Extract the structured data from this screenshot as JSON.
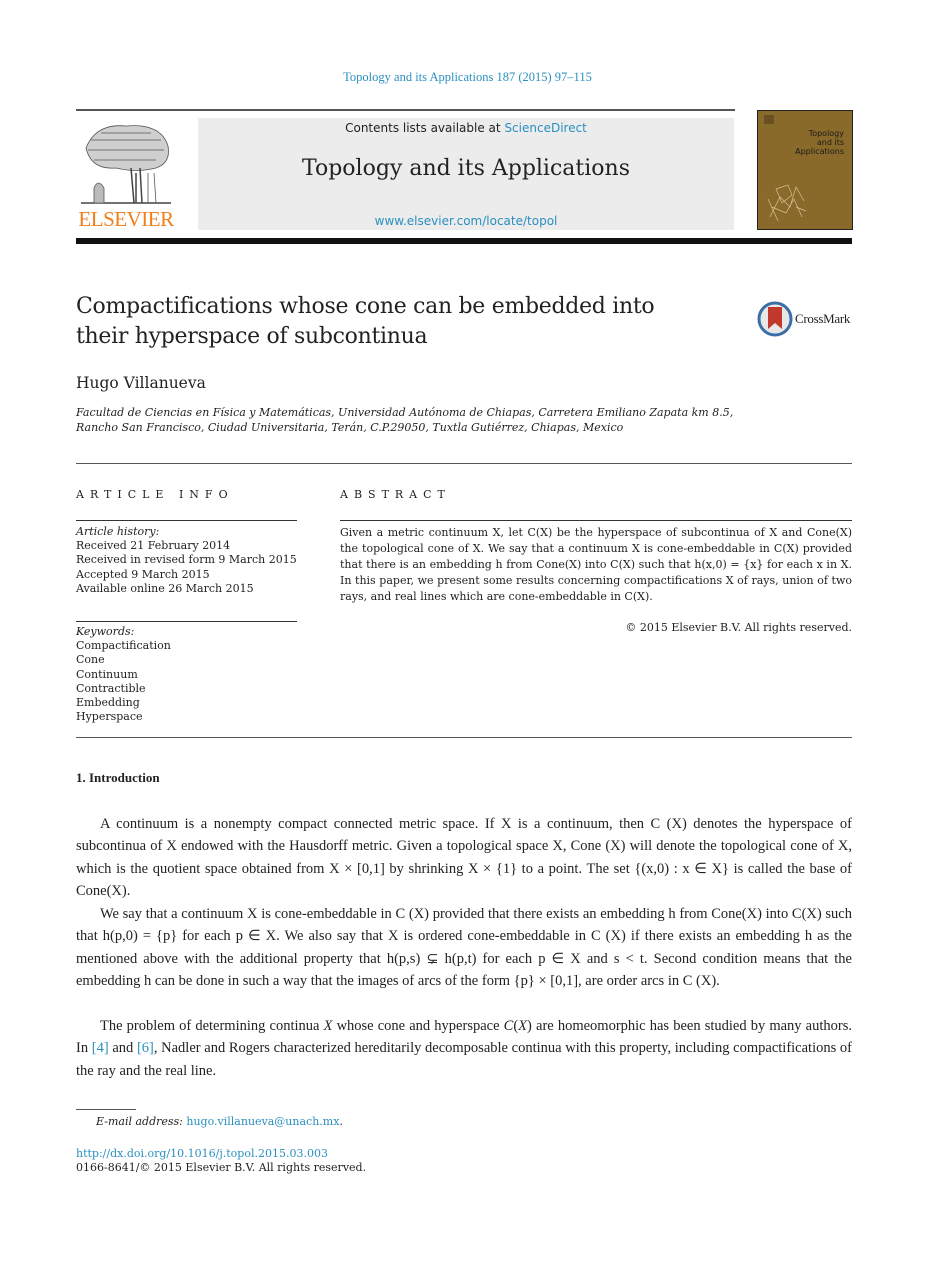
{
  "header": {
    "journal_ref": "Topology and its Applications 187 (2015) 97–115",
    "contents_prefix": "Contents lists available at ",
    "contents_link": "ScienceDirect",
    "journal_title": "Topology and its Applications",
    "journal_url": "www.elsevier.com/locate/topol",
    "publisher_logo_text": "ELSEVIER",
    "cover_title_lines": [
      "Topology",
      "and its",
      "Applications"
    ],
    "crossmark_label": "CrossMark"
  },
  "colors": {
    "link": "#2a8fbf",
    "elsevier_orange": "#f07e1b",
    "cover_brown": "#8a6a2a",
    "crossmark_red": "#c0392b"
  },
  "article": {
    "title": "Compactifications whose cone can be embedded into their hyperspace of subcontinua",
    "author": "Hugo Villanueva",
    "affiliation": "Facultad de Ciencias en Física y Matemáticas, Universidad Autónoma de Chiapas, Carretera Emiliano Zapata km 8.5, Rancho San Francisco, Ciudad Universitaria, Terán, C.P.29050, Tuxtla Gutiérrez, Chiapas, Mexico"
  },
  "article_info": {
    "heading": "ARTICLE INFO",
    "history_label": "Article history:",
    "history": [
      "Received 21 February 2014",
      "Received in revised form 9 March 2015",
      "Accepted 9 March 2015",
      "Available online 26 March 2015"
    ],
    "keywords_label": "Keywords:",
    "keywords": [
      "Compactification",
      "Cone",
      "Continuum",
      "Contractible",
      "Embedding",
      "Hyperspace"
    ]
  },
  "abstract": {
    "heading": "ABSTRACT",
    "text": "Given a metric continuum X, let C(X) be the hyperspace of subcontinua of X and Cone(X) the topological cone of X. We say that a continuum X is cone-embeddable in C(X) provided that there is an embedding h from Cone(X) into C(X) such that h(x,0) = {x} for each x in X. In this paper, we present some results concerning compactifications X of rays, union of two rays, and real lines which are cone-embeddable in C(X).",
    "copyright": "© 2015 Elsevier B.V. All rights reserved."
  },
  "section": {
    "heading": "1.  Introduction",
    "paragraphs": [
      "A continuum is a nonempty compact connected metric space. If X is a continuum, then C (X) denotes the hyperspace of subcontinua of X endowed with the Hausdorff metric. Given a topological space X, Cone (X) will denote the topological cone of X, which is the quotient space obtained from X × [0,1] by shrinking X × {1} to a point. The set {(x,0) : x ∈ X} is called the base of Cone(X).",
      "We say that a continuum X is cone-embeddable in C (X) provided that there exists an embedding h from Cone(X) into C(X) such that h(p,0) = {p} for each p ∈ X. We also say that X is ordered cone-embeddable in C (X) if there exists an embedding h as the mentioned above with the additional property that h(p,s) ⊊ h(p,t) for each p ∈ X and s < t. Second condition means that the embedding h can be done in such a way that the images of arcs of the form {p} × [0,1], are order arcs in C (X).",
      "The problem of determining continua X whose cone and hyperspace C(X) are homeomorphic has been studied by many authors. In [4] and [6], Nadler and Rogers characterized hereditarily decomposable continua with this property, including compactifications of the ray and the real line."
    ],
    "p1": {
      "a": "A ",
      "continuum": "continuum",
      "b": " is a nonempty compact connected metric space. If ",
      "c": " is a continuum, then ",
      "d": " denotes the hyperspace of subcontinua of ",
      "e": " endowed with the Hausdorff metric. Given a topological space ",
      "f": ", ",
      "g": " will denote the ",
      "topcone": "topological cone",
      "h": " of ",
      "i": ", which is the quotient space obtained from ",
      "j": " by shrinking ",
      "k": " to a point. The set ",
      "l": " is called the ",
      "base": "base of Cone",
      "m": "."
    },
    "p3": {
      "a": "The problem of determining continua ",
      "b": " whose cone and hyperspace ",
      "c": " are homeomorphic has been studied by many authors. In ",
      "ref1": "[4]",
      "d": " and ",
      "ref2": "[6]",
      "e": ", Nadler and Rogers characterized hereditarily decomposable continua with this property, including compactifications of the ray and the real line."
    }
  },
  "footnotes": {
    "email_label": "E-mail address:",
    "email": "hugo.villanueva@unach.mx",
    "doi": "http://dx.doi.org/10.1016/j.topol.2015.03.003",
    "issn_line": "0166-8641/© 2015 Elsevier B.V. All rights reserved."
  }
}
